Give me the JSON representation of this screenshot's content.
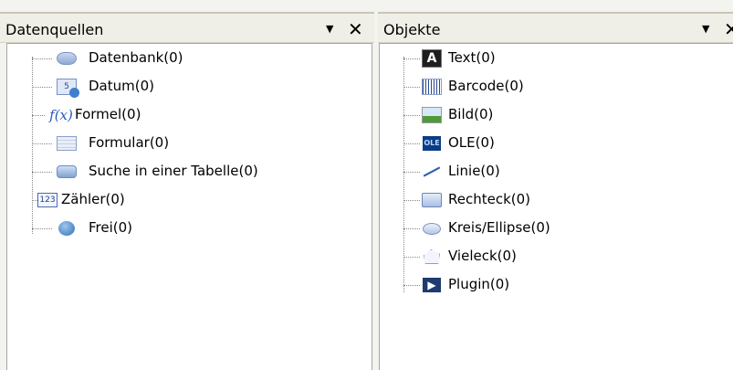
{
  "panels": {
    "datenquellen": {
      "title": "Datenquellen",
      "dropdown_icon": "triangle-down-icon",
      "close_icon": "close-icon",
      "items": [
        {
          "label": "Datenbank(0)",
          "icon": "database-icon"
        },
        {
          "label": "Datum(0)",
          "icon": "date-icon"
        },
        {
          "label": "Formel(0)",
          "icon": "formula-icon"
        },
        {
          "label": "Formular(0)",
          "icon": "form-icon"
        },
        {
          "label": "Suche in einer Tabelle(0)",
          "icon": "table-search-icon"
        },
        {
          "label": "Zähler(0)",
          "icon": "counter-icon"
        },
        {
          "label": "Frei(0)",
          "icon": "free-icon"
        }
      ]
    },
    "objekte": {
      "title": "Objekte",
      "dropdown_icon": "triangle-down-icon",
      "close_icon": "close-icon",
      "items": [
        {
          "label": "Text(0)",
          "icon": "text-icon"
        },
        {
          "label": "Barcode(0)",
          "icon": "barcode-icon"
        },
        {
          "label": "Bild(0)",
          "icon": "image-icon"
        },
        {
          "label": "OLE(0)",
          "icon": "ole-icon"
        },
        {
          "label": "Linie(0)",
          "icon": "line-icon"
        },
        {
          "label": "Rechteck(0)",
          "icon": "rectangle-icon"
        },
        {
          "label": "Kreis/Ellipse(0)",
          "icon": "ellipse-icon"
        },
        {
          "label": "Vieleck(0)",
          "icon": "polygon-icon"
        },
        {
          "label": "Plugin(0)",
          "icon": "plugin-icon"
        }
      ]
    }
  },
  "glyphs": {
    "dropdown": "▼",
    "close": "✕",
    "date_icon_text": "5",
    "formula_icon_text": "f(x)",
    "counter_icon_text": "123",
    "text_icon_text": "A",
    "ole_icon_text": "OLE",
    "plugin_icon_text": "▶"
  }
}
